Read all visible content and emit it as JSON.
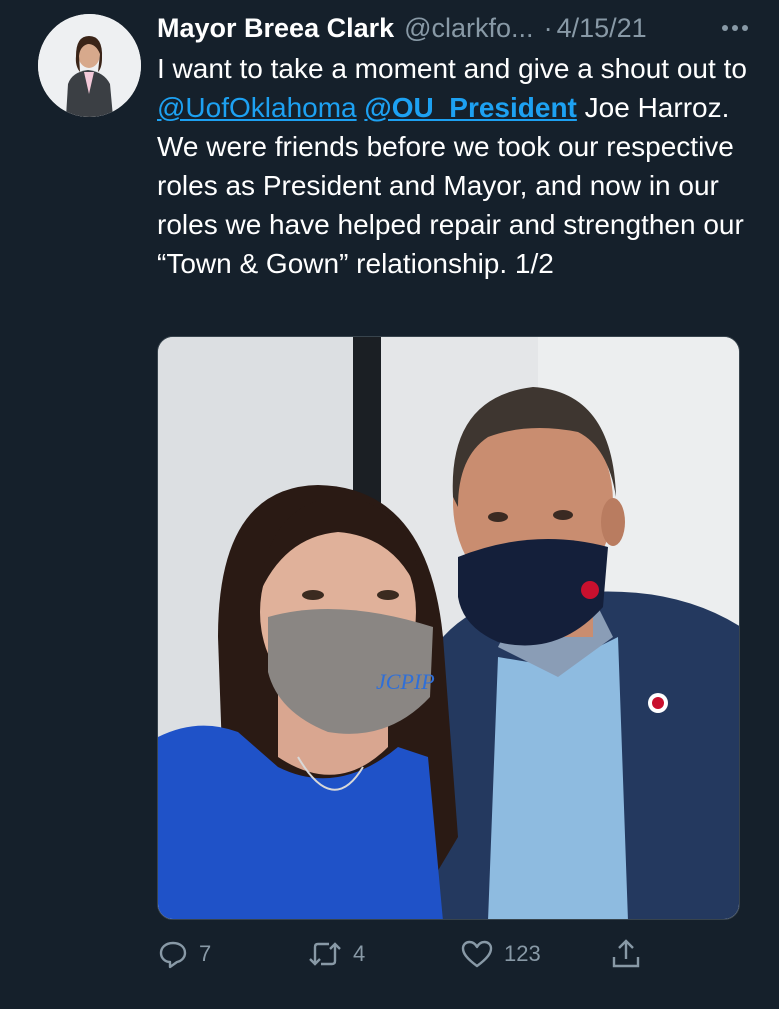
{
  "tweet": {
    "display_name": "Mayor Breea Clark",
    "handle": "@clarkfo...",
    "separator": "·",
    "date": "4/15/21",
    "text_part1": "I want to take a moment and give a shout out to ",
    "mention1": "@UofOklahoma",
    "space": " ",
    "mention2": "@OU_President",
    "text_part2": " Joe Harroz. We were friends before we took our respective roles as President and Mayor, and now in our roles we have helped repair and strengthen our “Town & Gown” relationship. 1/2",
    "media_mask_text": "JCPIP"
  },
  "actions": {
    "replies": "7",
    "retweets": "4",
    "likes": "123"
  },
  "colors": {
    "background": "#15202b",
    "text": "#ffffff",
    "muted": "#8899a6",
    "link": "#1da1f2"
  },
  "icons": {
    "more": "more-icon",
    "reply": "reply-icon",
    "retweet": "retweet-icon",
    "like": "like-icon",
    "share": "share-icon"
  }
}
